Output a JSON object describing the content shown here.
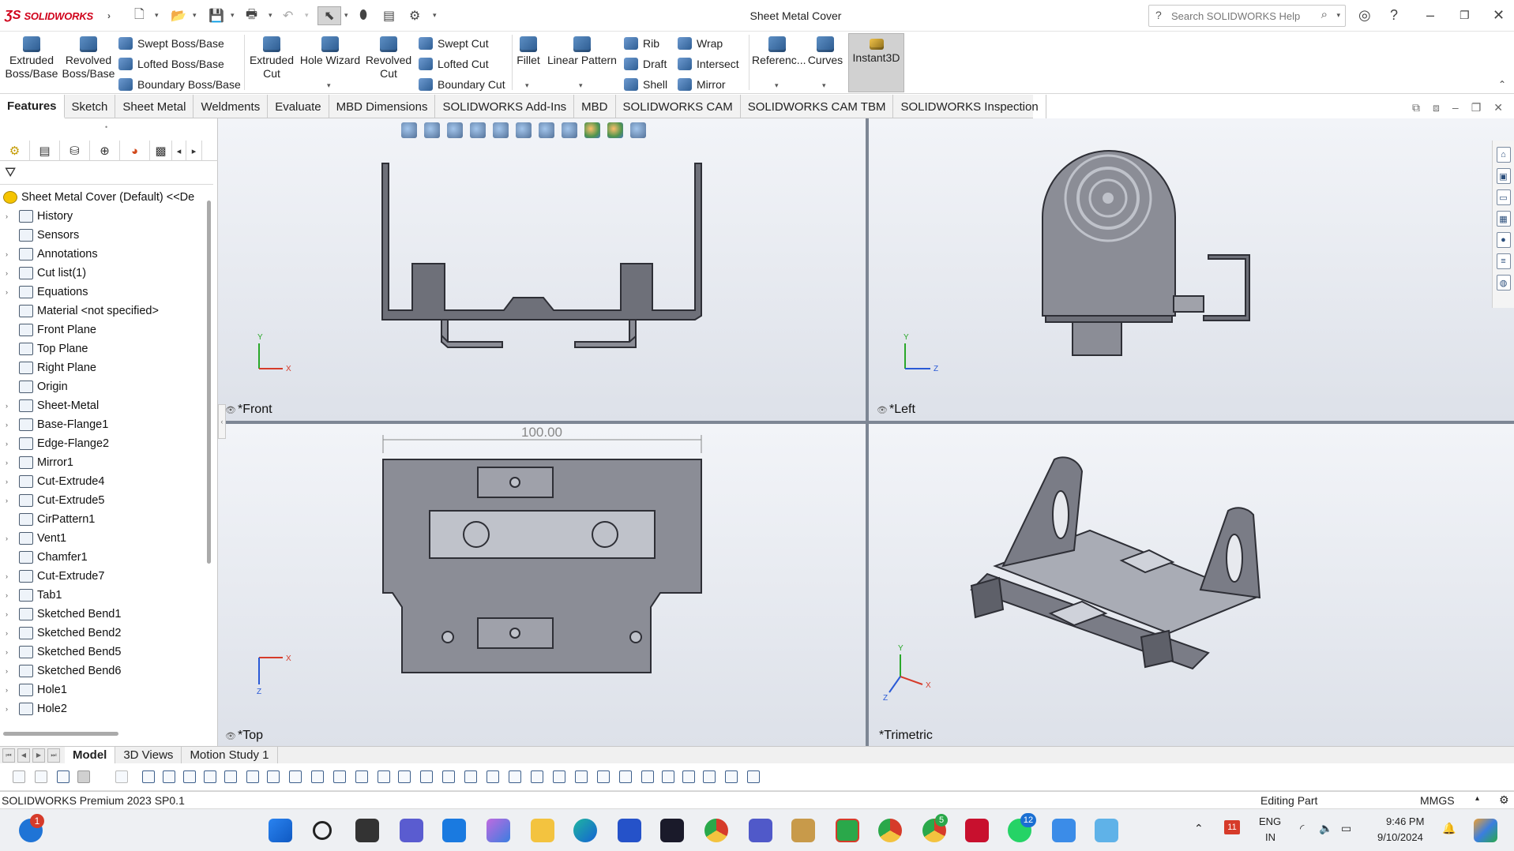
{
  "titlebar": {
    "logo": "SOLIDWORKS",
    "window_title": "Sheet Metal Cover",
    "search_placeholder": "Search SOLIDWORKS Help"
  },
  "ribbon": {
    "extruded_boss": "Extruded Boss/Base",
    "revolved_boss": "Revolved Boss/Base",
    "swept_boss": "Swept Boss/Base",
    "lofted_boss": "Lofted Boss/Base",
    "boundary_boss": "Boundary Boss/Base",
    "extruded_cut": "Extruded Cut",
    "hole_wizard": "Hole Wizard",
    "revolved_cut": "Revolved Cut",
    "swept_cut": "Swept Cut",
    "lofted_cut": "Lofted Cut",
    "boundary_cut": "Boundary Cut",
    "fillet": "Fillet",
    "linear_pattern": "Linear Pattern",
    "rib": "Rib",
    "draft": "Draft",
    "shell": "Shell",
    "wrap": "Wrap",
    "intersect": "Intersect",
    "mirror": "Mirror",
    "reference": "Referenc...",
    "curves": "Curves",
    "instant3d": "Instant3D"
  },
  "command_tabs": [
    "Features",
    "Sketch",
    "Sheet Metal",
    "Weldments",
    "Evaluate",
    "MBD Dimensions",
    "SOLIDWORKS Add-Ins",
    "MBD",
    "SOLIDWORKS CAM",
    "SOLIDWORKS CAM TBM",
    "SOLIDWORKS Inspection"
  ],
  "feature_tree": {
    "root": "Sheet Metal Cover (Default) <<De",
    "items": [
      "History",
      "Sensors",
      "Annotations",
      "Cut list(1)",
      "Equations",
      "Material <not specified>",
      "Front Plane",
      "Top Plane",
      "Right Plane",
      "Origin",
      "Sheet-Metal",
      "Base-Flange1",
      "Edge-Flange2",
      "Mirror1",
      "Cut-Extrude4",
      "Cut-Extrude5",
      "CirPattern1",
      "Vent1",
      "Chamfer1",
      "Cut-Extrude7",
      "Tab1",
      "Sketched Bend1",
      "Sketched Bend2",
      "Sketched Bend5",
      "Sketched Bend6",
      "Hole1",
      "Hole2"
    ]
  },
  "viewports": {
    "front": "*Front",
    "left": "*Left",
    "top": "*Top",
    "trimetric": "*Trimetric",
    "dimension": "100.00"
  },
  "axes": {
    "x": "X",
    "y": "Y",
    "z": "Z"
  },
  "bottom_tabs": [
    "Model",
    "3D Views",
    "Motion Study 1"
  ],
  "status": {
    "product": "SOLIDWORKS Premium 2023 SP0.1",
    "mode": "Editing Part",
    "units": "MMGS"
  },
  "taskbar": {
    "lang1": "ENG",
    "lang2": "IN",
    "time": "9:46 PM",
    "date": "9/10/2024",
    "mail_badge": "1",
    "chrome_badge": "5",
    "whatsapp_badge": "12",
    "calendar_badge": "11"
  },
  "colors": {
    "brand": "#d0021b",
    "part_fill": "#8b8d96",
    "part_stroke": "#2e2f36",
    "viewport_bg": "#e8ebf1"
  }
}
